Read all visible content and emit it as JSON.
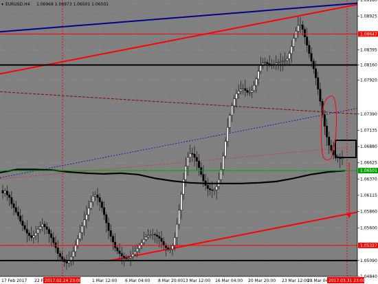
{
  "chart_header": {
    "symbol": "EURUSD,H4",
    "ohlc": "1.06968 1.06973 1.06501 1.06501"
  },
  "price_axis": {
    "ticks": [
      "1.09180",
      "1.08925",
      "1.08647",
      "1.08395",
      "1.08160",
      "1.07920",
      "1.07390",
      "1.07135",
      "1.06880",
      "1.06625",
      "1.06501",
      "1.06370",
      "1.06115",
      "1.05860",
      "1.05600",
      "1.05327",
      "1.05090",
      "1.04840"
    ],
    "highlight_labels": [
      {
        "text": "1.08647",
        "color": "#ff0000"
      },
      {
        "text": "1.06501",
        "color": "#00a000"
      },
      {
        "text": "1.05327",
        "color": "#ff0000"
      }
    ]
  },
  "time_axis": {
    "ticks": [
      "17 Feb 2017",
      "22 Feb",
      "1 Mar 12:00",
      "6 Mar 04:00",
      "8 Mar 20:00",
      "13 Mar 12:00",
      "16 Mar 04:00",
      "20 Mar 20:00",
      "23 Mar 12:00",
      "28 Mar 04:00"
    ],
    "highlight_labels": [
      "2017.02.24 23:00",
      "2017.03.31 23:00"
    ]
  },
  "colors": {
    "background": "#808080",
    "candle": "#000000",
    "support_red": "#ff0000",
    "trend_blue": "#00008b",
    "ma": "#000000",
    "green_level": "#00a000",
    "dashed_red": "#8b0000",
    "dashed_blue": "#0000cd"
  },
  "chart_data": {
    "type": "candlestick",
    "symbol": "EURUSD",
    "timeframe": "H4",
    "ylim": [
      1.0484,
      1.0918
    ],
    "horizontal_levels": [
      1.08647,
      1.0816,
      1.06501,
      1.05327,
      1.0509
    ],
    "close_series": [
      1.0615,
      1.0618,
      1.0612,
      1.0608,
      1.0598,
      1.0592,
      1.0585,
      1.0579,
      1.0571,
      1.0564,
      1.0558,
      1.0552,
      1.0548,
      1.0545,
      1.0548,
      1.0552,
      1.0558,
      1.0562,
      1.0566,
      1.0562,
      1.0558,
      1.0551,
      1.0545,
      1.0537,
      1.0529,
      1.052,
      1.0515,
      1.0511,
      1.0507,
      1.0505,
      1.0509,
      1.0515,
      1.0523,
      1.0533,
      1.0543,
      1.0553,
      1.0563,
      1.0573,
      1.0581,
      1.0591,
      1.0601,
      1.061,
      1.0612,
      1.0608,
      1.0601,
      1.0592,
      1.0581,
      1.0568,
      1.0556,
      1.0547,
      1.0538,
      1.0529,
      1.0524,
      1.052,
      1.0516,
      1.0513,
      1.0512,
      1.0513,
      1.0515,
      1.0519,
      1.0523,
      1.0528,
      1.0533,
      1.0537,
      1.0542,
      1.0546,
      1.0548,
      1.0549,
      1.055,
      1.0549,
      1.0547,
      1.0544,
      1.0539,
      1.0533,
      1.0529,
      1.0527,
      1.0527,
      1.0532,
      1.0545,
      1.0566,
      1.0588,
      1.0613,
      1.0636,
      1.0657,
      1.0671,
      1.0677,
      1.0676,
      1.0671,
      1.0665,
      1.0655,
      1.0644,
      1.0634,
      1.0627,
      1.0622,
      1.062,
      1.0619,
      1.062,
      1.0625,
      1.0636,
      1.0652,
      1.0673,
      1.0696,
      1.0718,
      1.0737,
      1.0752,
      1.0763,
      1.0771,
      1.0775,
      1.0778,
      1.0779,
      1.0776,
      1.0773,
      1.0773,
      1.0776,
      1.0784,
      1.0794,
      1.0806,
      1.0815,
      1.0819,
      1.082,
      1.0818,
      1.0816,
      1.0816,
      1.0817,
      1.0819,
      1.082,
      1.0821,
      1.0822,
      1.0823,
      1.0826,
      1.0834,
      1.0845,
      1.0858,
      1.0869,
      1.0878,
      1.0879,
      1.0872,
      1.086,
      1.0847,
      1.0834,
      1.0822,
      1.081,
      1.0796,
      1.0778,
      1.0759,
      1.0738,
      1.072,
      1.0703,
      1.069,
      1.0682,
      1.0675,
      1.0672,
      1.067,
      1.0669,
      1.0669
    ],
    "series": [
      {
        "name": "moving-average",
        "type": "line",
        "x": [
          0,
          0.05,
          0.1,
          0.15,
          0.2,
          0.25,
          0.3,
          0.35,
          0.4,
          0.45,
          0.5,
          0.55,
          0.6,
          0.65,
          0.7,
          0.75,
          0.8,
          0.85,
          0.9,
          0.95,
          1
        ],
        "y": [
          1.0647,
          1.0652,
          1.0652,
          1.0651,
          1.0648,
          1.0646,
          1.0645,
          1.0646,
          1.0644,
          1.0638,
          1.0634,
          1.0631,
          1.063,
          1.063,
          1.063,
          1.0631,
          1.0633,
          1.0638,
          1.0644,
          1.0648,
          1.065
        ]
      }
    ],
    "trendlines": [
      {
        "name": "blue-resistance",
        "from": [
          0,
          1.0868
        ],
        "to": [
          1,
          1.0913
        ]
      },
      {
        "name": "red-upper-channel",
        "from": [
          0,
          1.0802
        ],
        "to": [
          1,
          1.0911
        ]
      },
      {
        "name": "red-lower-channel",
        "from": [
          0.3,
          1.0508
        ],
        "to": [
          1,
          1.0585
        ]
      },
      {
        "name": "red-dashed",
        "from": [
          0,
          1.0774
        ],
        "to": [
          1,
          1.0739
        ]
      },
      {
        "name": "blue-dashed",
        "from": [
          0,
          1.0639
        ],
        "to": [
          1,
          1.0748
        ]
      },
      {
        "name": "red-dotted",
        "from": [
          0,
          1.0637
        ],
        "to": [
          1,
          1.0688
        ]
      }
    ]
  }
}
